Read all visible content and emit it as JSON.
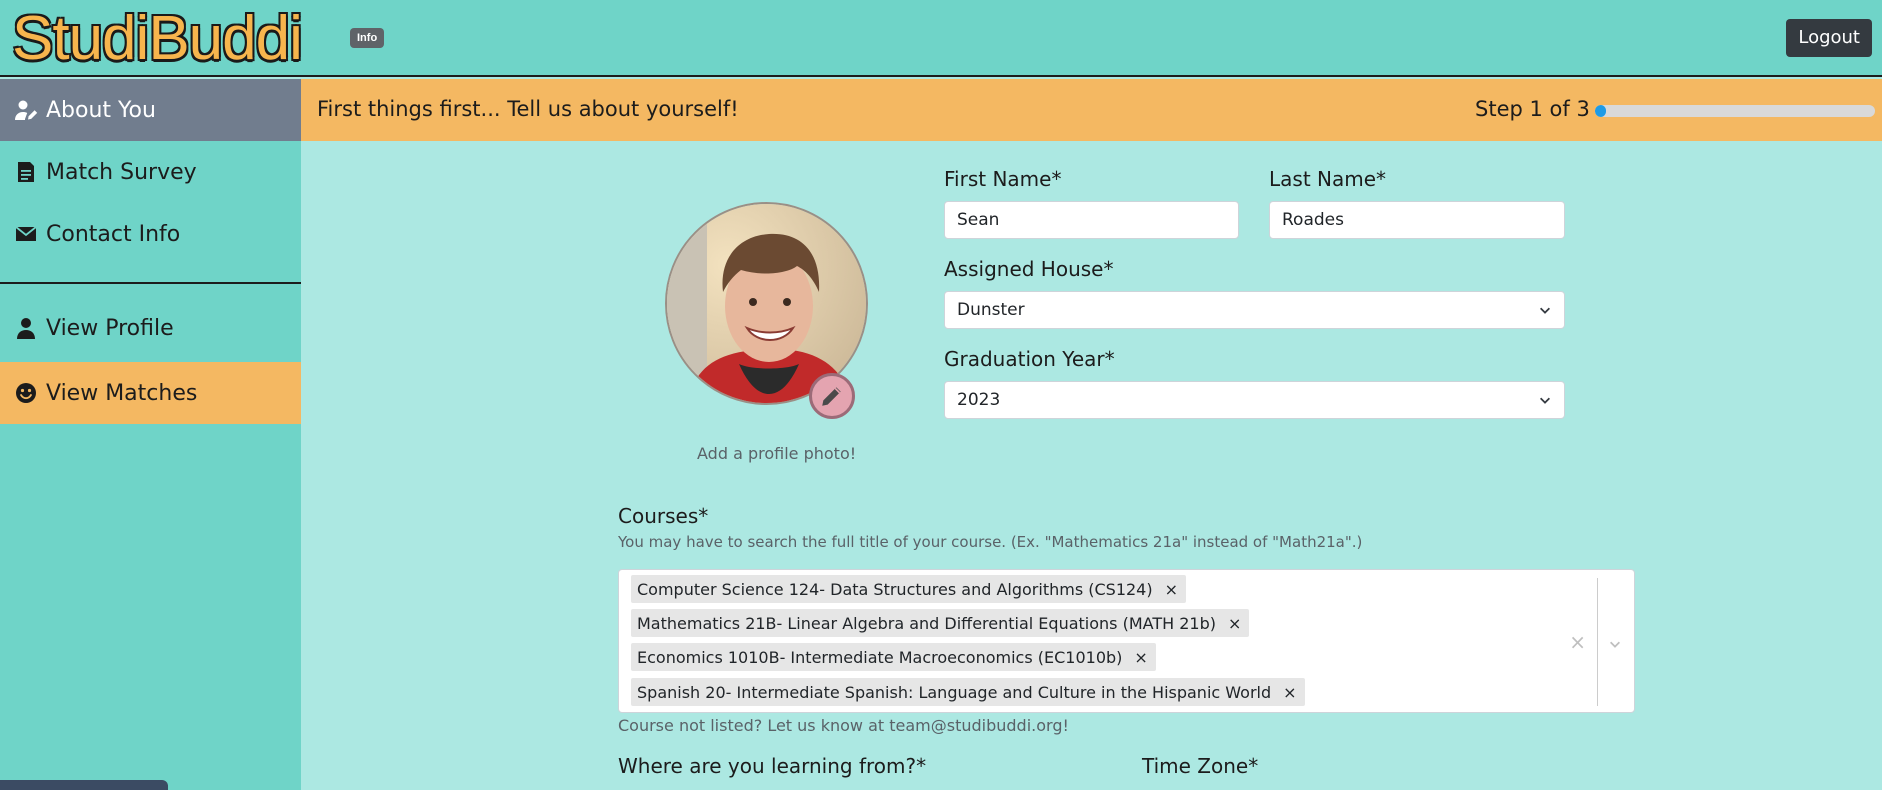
{
  "header": {
    "logo": "StudiBuddi",
    "info_badge": "Info",
    "logout_label": "Logout"
  },
  "sidebar": {
    "items": [
      {
        "label": "About You",
        "icon": "user-edit-icon",
        "state": "active"
      },
      {
        "label": "Match Survey",
        "icon": "file-alt-icon"
      },
      {
        "label": "Contact Info",
        "icon": "envelope-icon"
      },
      {
        "label": "View Profile",
        "icon": "user-icon"
      },
      {
        "label": "View Matches",
        "icon": "smile-icon",
        "state": "highlighted"
      }
    ]
  },
  "banner": {
    "text": "First things first... Tell us about yourself!",
    "step_text": "Step 1 of 3",
    "progress_fraction": 0.04
  },
  "profile": {
    "photo_caption": "Add a profile photo!"
  },
  "form": {
    "first_name_label": "First Name*",
    "first_name_value": "Sean",
    "last_name_label": "Last Name*",
    "last_name_value": "Roades",
    "house_label": "Assigned House*",
    "house_value": "Dunster",
    "year_label": "Graduation Year*",
    "year_value": "2023",
    "courses_label": "Courses*",
    "courses_help": "You may have to search the full title of your course. (Ex. \"Mathematics 21a\" instead of \"Math21a\".)",
    "courses": [
      "Computer Science 124- Data Structures and Algorithms (CS124)",
      "Mathematics 21B- Linear Algebra and Differential Equations (MATH 21b)",
      "Economics 1010B- Intermediate Macroeconomics (EC1010b)",
      "Spanish 20- Intermediate Spanish: Language and Culture in the Hispanic World"
    ],
    "chip_remove": "×",
    "clear_all": "×",
    "course_not_listed": "Course not listed? Let us know at team@studibuddi.org!",
    "location_label": "Where are you learning from?*",
    "timezone_label": "Time Zone*"
  },
  "colors": {
    "header_bg": "#6fd4c8",
    "accent_orange": "#f4b862",
    "page_bg": "#ace8e2",
    "active_nav": "#717d8e",
    "progress": "#1e9be6"
  }
}
